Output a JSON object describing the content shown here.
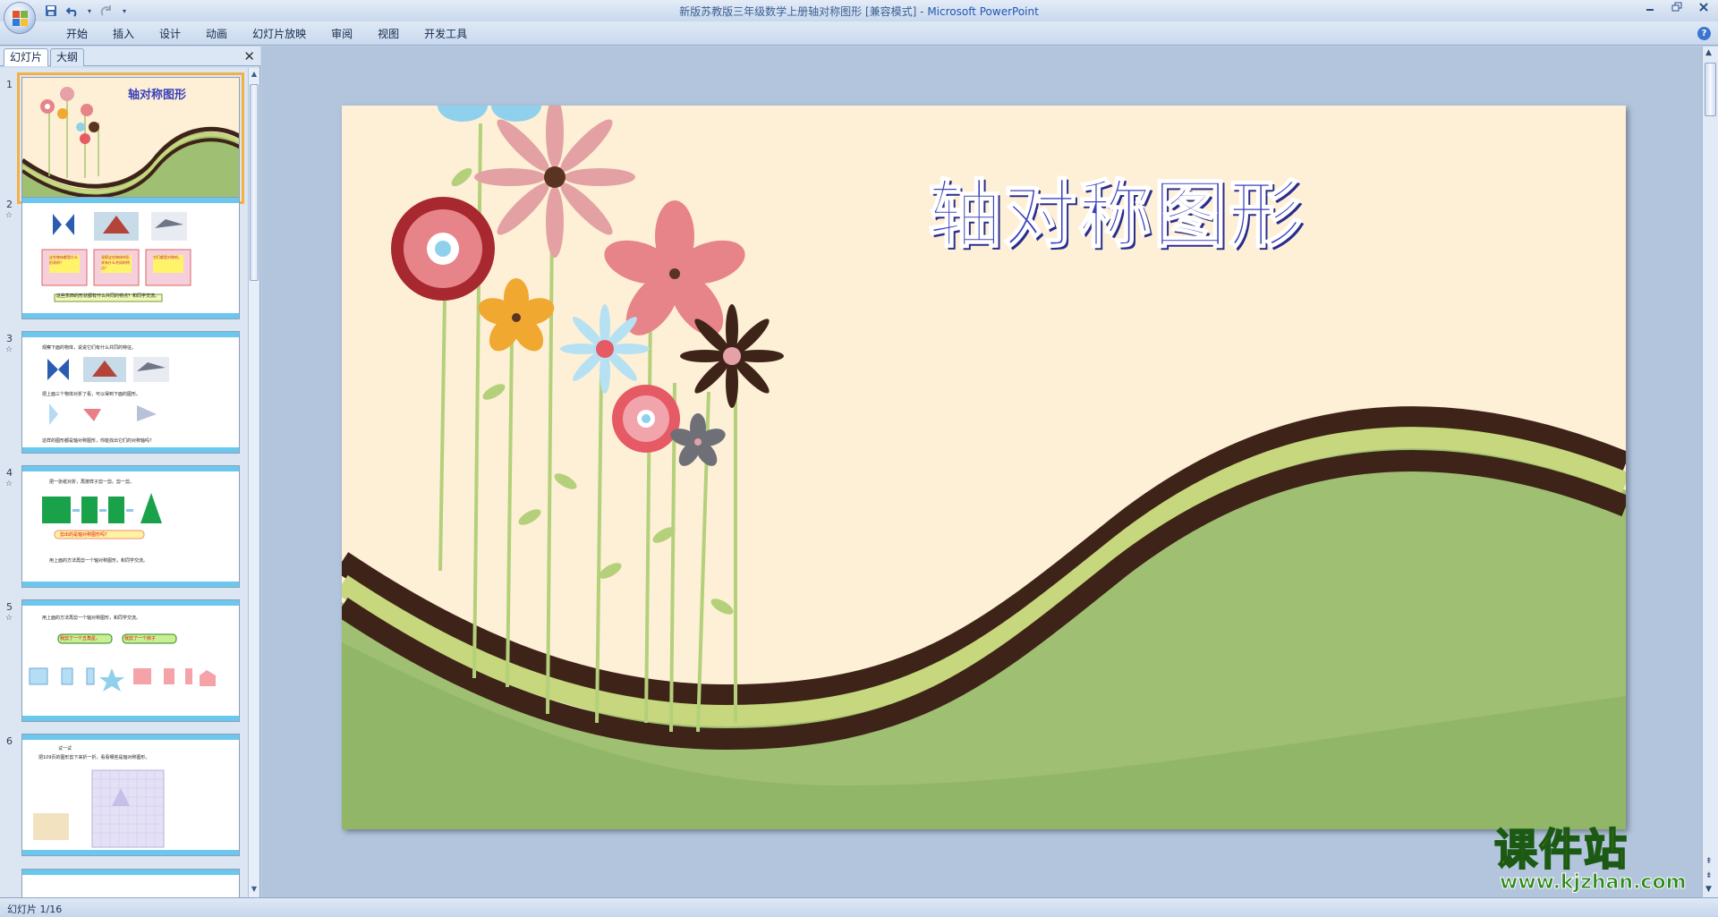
{
  "window": {
    "title": "新版苏教版三年级数学上册轴对称图形 [兼容模式]",
    "separator": " - ",
    "app_name": "Microsoft PowerPoint",
    "controls": [
      "minimize-icon",
      "restore-icon",
      "close-icon"
    ]
  },
  "quick_access": {
    "icons": [
      "save-icon",
      "undo-icon",
      "undo-dropdown-icon",
      "redo-icon",
      "customize-qat-icon"
    ]
  },
  "ribbon": {
    "tabs": [
      "开始",
      "插入",
      "设计",
      "动画",
      "幻灯片放映",
      "审阅",
      "视图",
      "开发工具"
    ],
    "help": "?"
  },
  "pane": {
    "tabs": [
      "幻灯片",
      "大纲"
    ],
    "close": "✕",
    "thumbnails": [
      {
        "number": "1",
        "title": "轴对称图形",
        "selected": true
      },
      {
        "number": "2",
        "bottom_text": "这些东西的形状都有什么共同的特点？和同学交流。",
        "box_texts": [
          "这些物体都是什么形状的？",
          "观察这些物体的形状有什么共同的特点？",
          "它们都是对称的。"
        ]
      },
      {
        "number": "3",
        "top_text": "观察下面的物体，说说它们有什么共同的特征。",
        "mid_text": "把上面三个物体对折了看，可以得到下面的图形。",
        "bottom_text": "这样的图形都是轴对称图形，你能找出它们的对称轴吗？"
      },
      {
        "number": "4",
        "top_text": "把一张纸对折，再按样子剪一剪。剪一剪。",
        "question": "剪出的是轴对称图形吗？",
        "bottom_text": "用上面的方法再剪一个轴对称图形，和同学交流。"
      },
      {
        "number": "5",
        "top_text": "用上面的方法再剪一个轴对称图形，和同学交流。",
        "bubble_left": "我剪了一个五角星。",
        "bubble_right": "我剪了一个房子"
      },
      {
        "number": "6",
        "label": "试一试",
        "top_text": "把109页的图形剪下来折一折，看看哪些是轴对称图形。"
      }
    ]
  },
  "slide": {
    "title": "轴对称图形"
  },
  "watermark": {
    "title": "课件站",
    "url": "www.kjzhan.com"
  },
  "status": {
    "text": "幻灯片 1/16"
  },
  "colors": {
    "slide_background": "#fdf0d7",
    "title_color": "#3a3fb8",
    "hill_green": "#9fbf72",
    "band_brown": "#3e2418",
    "band_lime": "#c6d77d",
    "selection_outline": "#f5b043"
  }
}
